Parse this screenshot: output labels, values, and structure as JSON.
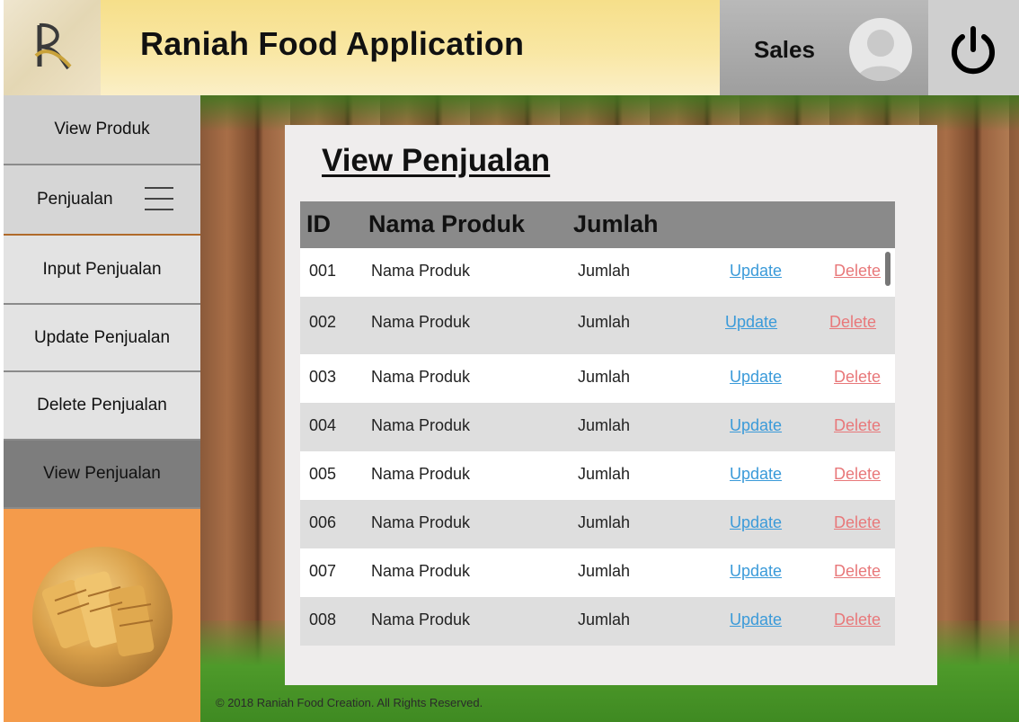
{
  "header": {
    "app_title": "Raniah Food Application",
    "user_role": "Sales"
  },
  "sidebar": {
    "items": [
      {
        "label": "View Produk"
      },
      {
        "label": "Penjualan"
      },
      {
        "label": "Input Penjualan"
      },
      {
        "label": "Update Penjualan"
      },
      {
        "label": "Delete Penjualan"
      },
      {
        "label": "View Penjualan"
      }
    ]
  },
  "main": {
    "title": "View Penjualan",
    "table": {
      "columns": [
        "ID",
        "Nama Produk",
        "Jumlah"
      ],
      "update_label": "Update",
      "delete_label": "Delete",
      "rows": [
        {
          "id": "001",
          "nama": "Nama Produk",
          "jumlah": "Jumlah"
        },
        {
          "id": "002",
          "nama": "Nama Produk",
          "jumlah": "Jumlah"
        },
        {
          "id": "003",
          "nama": "Nama Produk",
          "jumlah": "Jumlah"
        },
        {
          "id": "004",
          "nama": "Nama Produk",
          "jumlah": "Jumlah"
        },
        {
          "id": "005",
          "nama": "Nama Produk",
          "jumlah": "Jumlah"
        },
        {
          "id": "006",
          "nama": "Nama Produk",
          "jumlah": "Jumlah"
        },
        {
          "id": "007",
          "nama": "Nama Produk",
          "jumlah": "Jumlah"
        },
        {
          "id": "008",
          "nama": "Nama Produk",
          "jumlah": "Jumlah"
        }
      ]
    }
  },
  "footer": {
    "text": "© 2018 Raniah Food Creation. All Rights Reserved."
  },
  "colors": {
    "header_yellow": "#f6df8a",
    "promo_orange": "#f49b4b",
    "update_link": "#3a9ad9",
    "delete_link": "#e8787a"
  },
  "icons": {
    "logo": "logo-r-icon",
    "avatar": "user-avatar-icon",
    "power": "power-icon",
    "menu": "hamburger-menu-icon"
  }
}
